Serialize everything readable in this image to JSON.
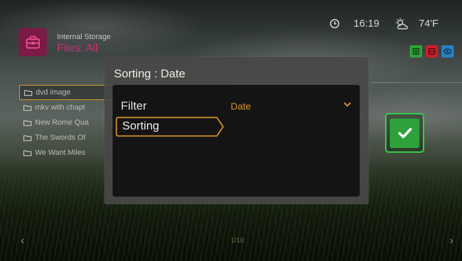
{
  "header": {
    "breadcrumb": "Internal Storage",
    "section_title": "Files: All",
    "app_icon": "storage-briefcase-icon",
    "accent_color": "#d12c75"
  },
  "status_bar": {
    "time": "16:19",
    "temperature": "74'F",
    "clock_icon": "clock-icon",
    "weather_icon": "partly-cloudy-icon"
  },
  "view_modes": [
    {
      "icon": "grid-view-icon",
      "color": "#2fa13a"
    },
    {
      "icon": "list-view-icon",
      "color": "#c8202e"
    },
    {
      "icon": "preview-view-icon",
      "color": "#2a7fc0"
    }
  ],
  "file_list": {
    "items": [
      {
        "label": "dvd image",
        "selected": true
      },
      {
        "label": "mkv with chapt",
        "selected": false
      },
      {
        "label": "New Rome Qua",
        "selected": false
      },
      {
        "label": "The Swords Of",
        "selected": false
      },
      {
        "label": "We Want Miles",
        "selected": false
      }
    ]
  },
  "pagination": {
    "indicator": "1/10"
  },
  "dialog": {
    "title": "Sorting : Date",
    "filter_label": "Filter",
    "filter_value": "Date",
    "sorting_label": "Sorting",
    "highlight_color": "#d9952a"
  },
  "confirm": {
    "icon": "checkmark-icon",
    "color": "#2fa13a"
  }
}
